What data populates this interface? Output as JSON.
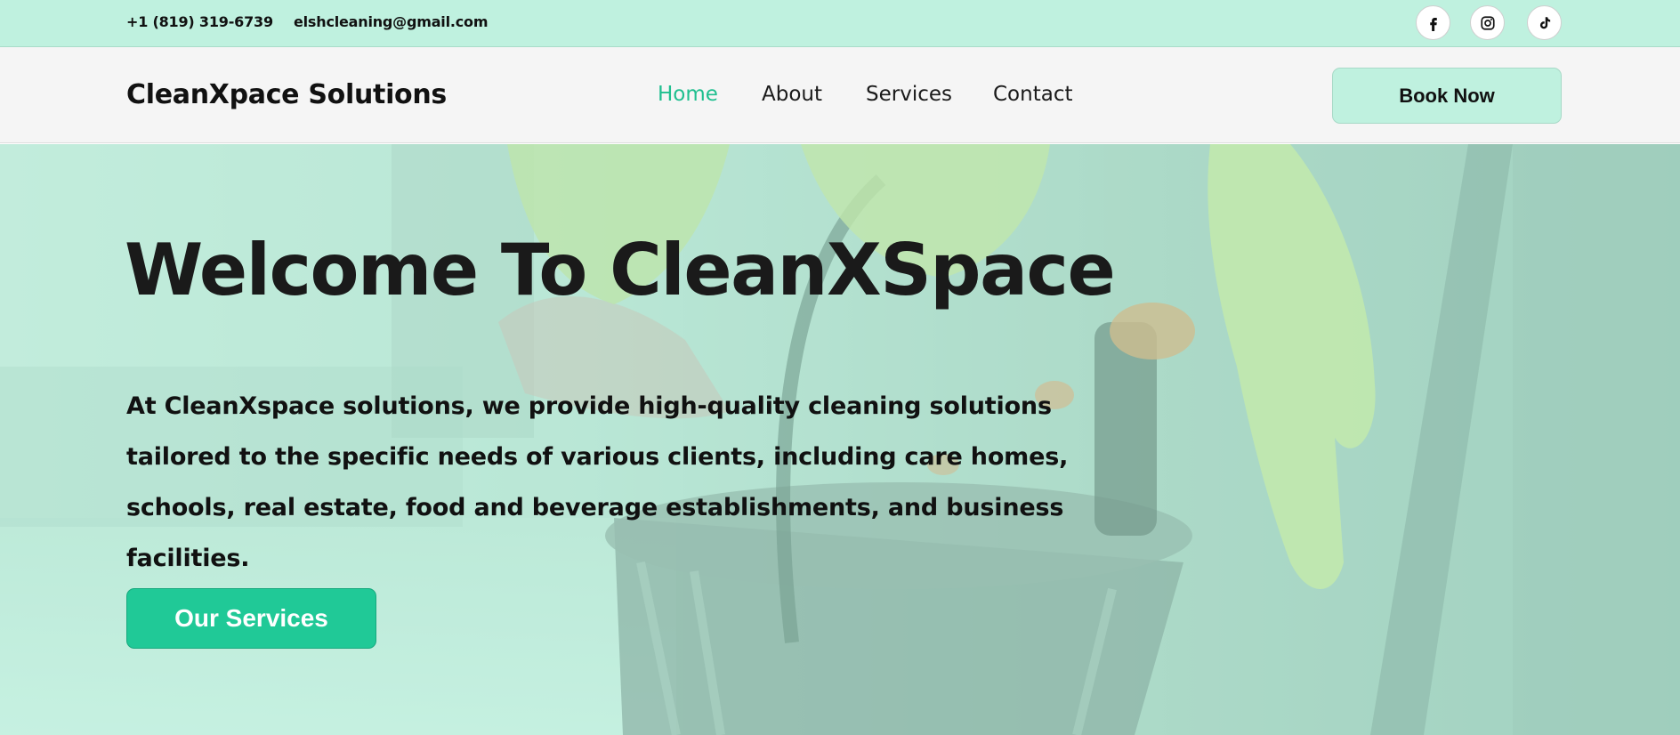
{
  "topbar": {
    "phone": "+1 (819) 319-6739",
    "email": "elshcleaning@gmail.com",
    "social": [
      {
        "icon": "facebook-icon"
      },
      {
        "icon": "instagram-icon"
      },
      {
        "icon": "tiktok-icon"
      }
    ]
  },
  "nav": {
    "brand": "CleanXpace Solutions",
    "links": [
      {
        "label": "Home",
        "active": true
      },
      {
        "label": "About",
        "active": false
      },
      {
        "label": "Services",
        "active": false
      },
      {
        "label": "Contact",
        "active": false
      }
    ],
    "cta": "Book Now"
  },
  "hero": {
    "title": "Welcome To CleanXSpace",
    "text": "At CleanXspace solutions, we provide high-quality cleaning solutions tailored to the specific needs of various clients, including care homes, schools, real estate, food and beverage establishments, and business facilities.",
    "button": "Our Services"
  },
  "colors": {
    "accent": "#20c997",
    "active_link": "#1fbf8f",
    "mint": "#bff1df",
    "nav_bg": "#f5f5f5"
  }
}
